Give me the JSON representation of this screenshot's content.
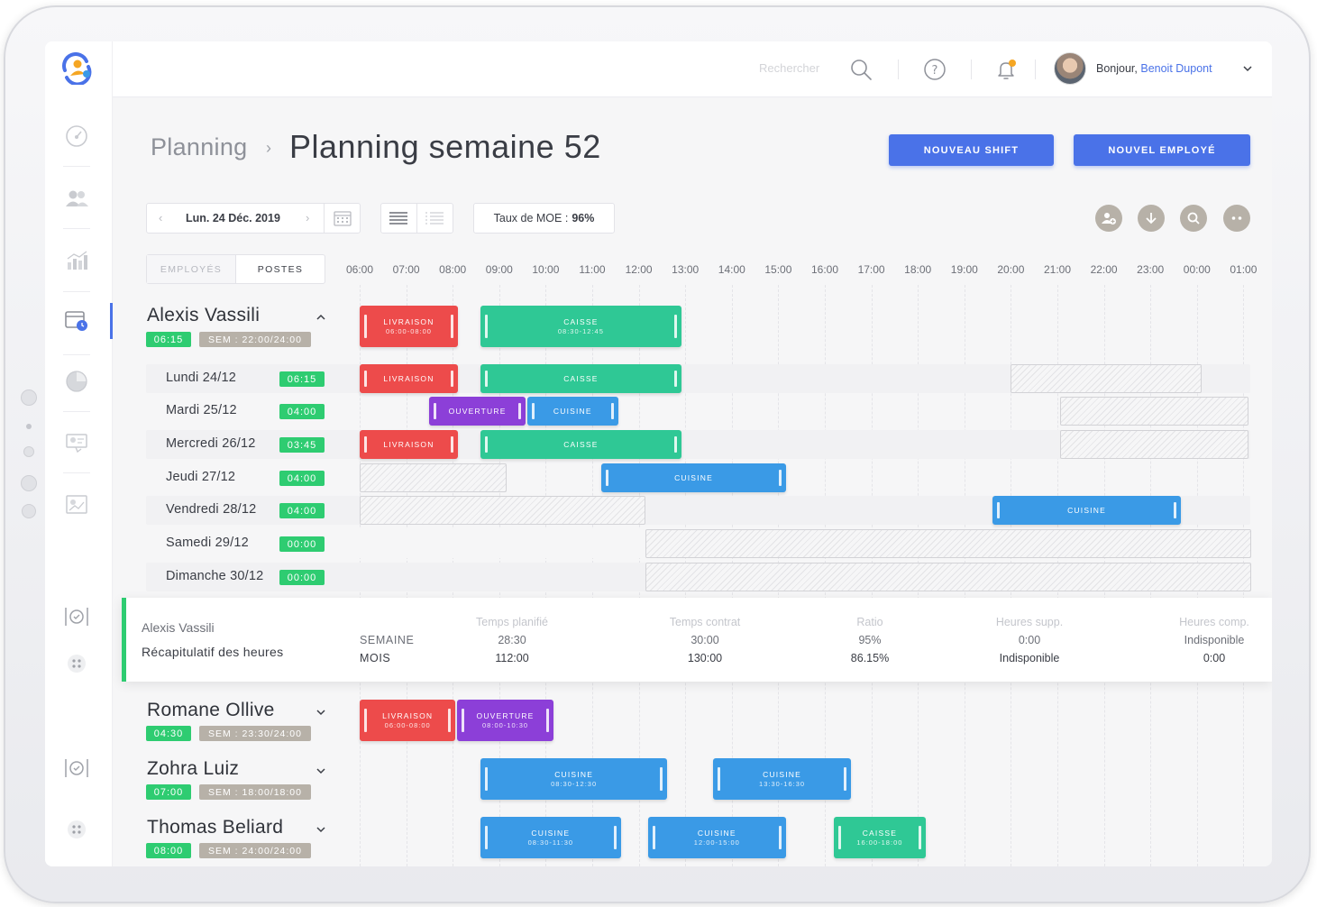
{
  "header": {
    "search_placeholder": "Rechercher",
    "greeting": "Bonjour,",
    "user_name": "Benoit Dupont"
  },
  "sidebar": {
    "items": [
      "dashboard-icon",
      "team-icon",
      "stats-icon",
      "planning-icon",
      "pie-icon",
      "id-card-icon",
      "report-icon",
      "dish-icon",
      "apps-icon",
      "dish-icon",
      "apps-icon"
    ],
    "active": "planning-icon"
  },
  "breadcrumb": {
    "root": "Planning",
    "separator": "›",
    "title": "Planning semaine 52"
  },
  "actions": {
    "new_shift": "NOUVEAU SHIFT",
    "new_employee": "NOUVEL EMPLOYÉ"
  },
  "toolbar": {
    "date": "Lun. 24 Déc. 2019",
    "moe_label": "Taux de MOE :",
    "moe_value": "96%",
    "round_buttons": [
      "add-user-icon",
      "download-icon",
      "search-icon",
      "more-icon"
    ]
  },
  "tabs": {
    "employees": "EMPLOYÉS",
    "positions": "POSTES"
  },
  "hours": [
    "06:00",
    "07:00",
    "08:00",
    "09:00",
    "10:00",
    "11:00",
    "12:00",
    "13:00",
    "14:00",
    "15:00",
    "16:00",
    "17:00",
    "18:00",
    "19:00",
    "20:00",
    "21:00",
    "22:00",
    "23:00",
    "00:00",
    "01:00"
  ],
  "expanded_employee": {
    "name": "Alexis Vassili",
    "hours": "06:15",
    "week": "SEM : 22:00/24:00",
    "summary_shifts": [
      {
        "label": "LIVRAISON",
        "time": "06:00-08:00"
      },
      {
        "label": "CAISSE",
        "time": "08:30-12:45"
      }
    ],
    "days": [
      {
        "label": "Lundi 24/12",
        "hours": "06:15",
        "shifts": [
          {
            "label": "LIVRAISON"
          },
          {
            "label": "CAISSE"
          }
        ]
      },
      {
        "label": "Mardi 25/12",
        "hours": "04:00",
        "shifts": [
          {
            "label": "OUVERTURE"
          },
          {
            "label": "CUISINE"
          }
        ]
      },
      {
        "label": "Mercredi 26/12",
        "hours": "03:45",
        "shifts": [
          {
            "label": "LIVRAISON"
          },
          {
            "label": "CAISSE"
          }
        ]
      },
      {
        "label": "Jeudi 27/12",
        "hours": "04:00",
        "shifts": [
          {
            "label": "CUISINE"
          }
        ]
      },
      {
        "label": "Vendredi 28/12",
        "hours": "04:00",
        "shifts": [
          {
            "label": "CUISINE"
          }
        ]
      },
      {
        "label": "Samedi 29/12",
        "hours": "00:00",
        "shifts": []
      },
      {
        "label": "Dimanche 30/12",
        "hours": "00:00",
        "shifts": []
      }
    ]
  },
  "recap": {
    "name": "Alexis Vassili",
    "title": "Récapitulatif des heures",
    "columns": [
      "Temps planifié",
      "Temps contrat",
      "Ratio",
      "Heures supp.",
      "Heures comp."
    ],
    "rows": [
      {
        "label": "SEMAINE",
        "values": [
          "28:30",
          "30:00",
          "95%",
          "0:00",
          "Indisponible"
        ]
      },
      {
        "label": "MOIS",
        "values": [
          "112:00",
          "130:00",
          "86.15%",
          "Indisponible",
          "0:00"
        ]
      }
    ]
  },
  "other_employees": [
    {
      "name": "Romane Ollive",
      "hours": "04:30",
      "week": "SEM : 23:30/24:00",
      "shifts": [
        {
          "label": "LIVRAISON",
          "time": "06:00-08:00"
        },
        {
          "label": "OUVERTURE",
          "time": "08:00-10:30"
        }
      ]
    },
    {
      "name": "Zohra Luiz",
      "hours": "07:00",
      "week": "SEM : 18:00/18:00",
      "shifts": [
        {
          "label": "CUISINE",
          "time": "08:30-12:30"
        },
        {
          "label": "CUISINE",
          "time": "13:30-16:30"
        }
      ]
    },
    {
      "name": "Thomas Beliard",
      "hours": "08:00",
      "week": "SEM : 24:00/24:00",
      "shifts": [
        {
          "label": "CUISINE",
          "time": "08:30-11:30"
        },
        {
          "label": "CUISINE",
          "time": "12:00-15:00"
        },
        {
          "label": "CAISSE",
          "time": "16:00-18:00"
        }
      ]
    }
  ],
  "colors": {
    "accent": "#4a72e8",
    "livraison": "#ed4b4b",
    "caisse": "#2fc895",
    "cuisine": "#3a9ae6",
    "ouverture": "#8c3fd8",
    "hours_badge": "#2ecc71",
    "week_badge": "#b7b1a8"
  }
}
